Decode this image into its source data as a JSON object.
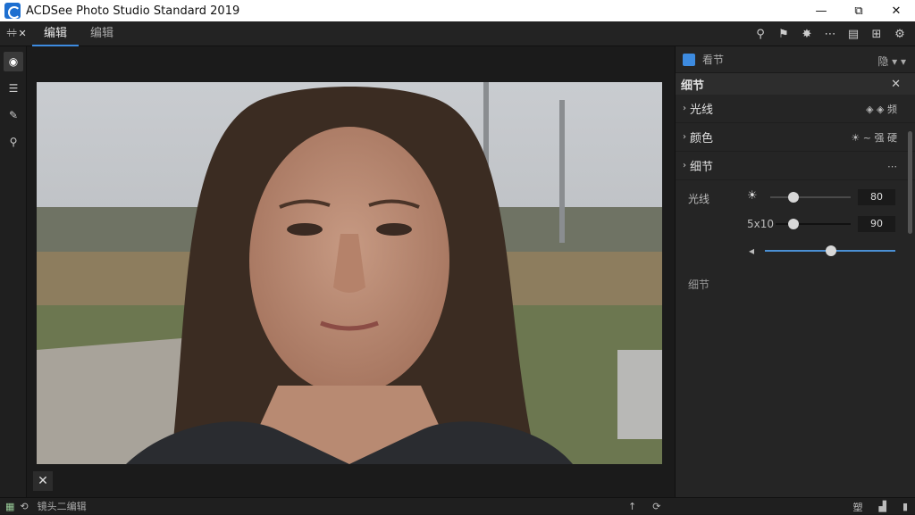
{
  "window": {
    "title": "ACDSee Photo Studio Standard 2019",
    "minimize": "—",
    "maximize": "⧉",
    "close": "✕"
  },
  "toolbar": {
    "tools_label": "⫩⫩ ✕",
    "tabs": [
      {
        "label": "编辑",
        "active": true
      },
      {
        "label": "编辑",
        "active": false
      }
    ],
    "right_icons": [
      "search-icon",
      "bookmark-icon",
      "gear-icon",
      "more-icon",
      "monitor-icon",
      "grid-icon",
      "settings-icon"
    ],
    "right_glyphs": [
      "⚲",
      "⚑",
      "✸",
      "⋯",
      "▤",
      "⊞",
      "⚙"
    ]
  },
  "leftbar": {
    "icons": [
      "eye-icon",
      "layers-icon",
      "brush-icon",
      "zoom-icon"
    ],
    "glyphs": [
      "◉",
      "☰",
      "✎",
      "⚲"
    ]
  },
  "canvas": {
    "close_glyph": "✕"
  },
  "panel": {
    "header_title": "看节",
    "header_right": "隐 ▾ ▾",
    "sub_title": "细节",
    "sub_close": "✕",
    "sections": [
      {
        "label": "光线",
        "right": "◈ ◈ 频"
      },
      {
        "label": "颜色",
        "right": "☀ ~ 强 硬"
      },
      {
        "label": "细节",
        "right": "⋯"
      }
    ],
    "sliders": [
      {
        "label": "光线",
        "value": "80",
        "level": 0.27
      },
      {
        "label": "5x10",
        "value": "90",
        "level": 0.22
      },
      {
        "label": "◂",
        "value": "",
        "level": 0.5
      }
    ],
    "sub_label": "细节"
  },
  "status": {
    "text": "镜头二编辑",
    "right_labels": [
      "塑",
      "▟"
    ],
    "mid_glyphs": [
      "↑",
      "⟳"
    ]
  }
}
